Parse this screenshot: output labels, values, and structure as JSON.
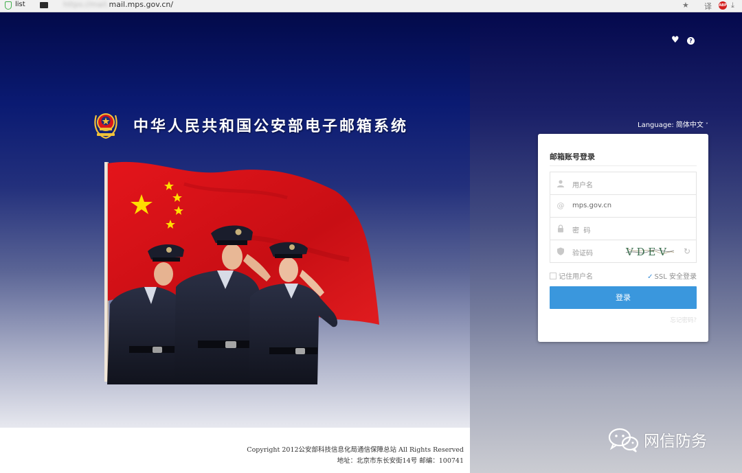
{
  "browser": {
    "tab_label": "list",
    "url": "mail.mps.gov.cn/",
    "url_obscured_prefix": "https://mail.",
    "ext_translate": "译"
  },
  "brand": {
    "site_title": "中华人民共和国公安部电子邮箱系统",
    "icons": [
      "favorite-heart-icon",
      "help-icon",
      "national-police-emblem",
      "chinese-flag"
    ]
  },
  "language": {
    "label": "Language:",
    "selected": "简体中文"
  },
  "login": {
    "heading": "邮箱账号登录",
    "username_placeholder": "用户名",
    "domain_value": "mps.gov.cn",
    "password_placeholder": "密  码",
    "captcha_placeholder": "验证码",
    "captcha_text": "V D E V",
    "remember_label": "记住用户名",
    "ssl_label": "SSL 安全登录",
    "submit_label": "登录",
    "forgot_label": "忘记密码?"
  },
  "footer": {
    "copyright": "Copyright 2012公安部科技信息化局通信保障总站 All Rights Reserved",
    "address": "地址：北京市东长安街14号   邮编：100741"
  },
  "watermark": {
    "text": "网信防务"
  },
  "colors": {
    "accent_blue": "#3a97dd",
    "navy": "#04094d",
    "flag_red": "#d8141a",
    "star_yellow": "#ffde00"
  }
}
